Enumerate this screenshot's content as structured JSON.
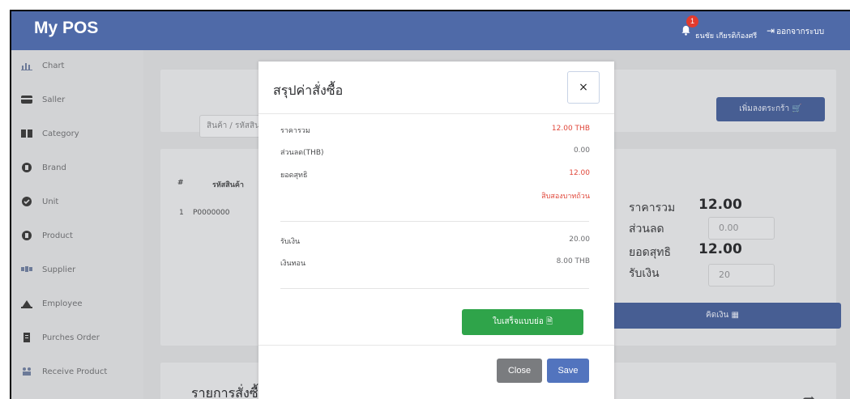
{
  "topbar": {
    "brand": "My POS",
    "notification_count": "1",
    "user_name": "ธนชัย เกียรติก้องศรี",
    "logout_label": "ออกจากระบบ"
  },
  "sidebar": {
    "items": [
      {
        "label": "Chart",
        "icon": "chart-icon"
      },
      {
        "label": "Saller",
        "icon": "seller-icon"
      },
      {
        "label": "Category",
        "icon": "category-icon"
      },
      {
        "label": "Brand",
        "icon": "brand-icon"
      },
      {
        "label": "Unit",
        "icon": "unit-icon"
      },
      {
        "label": "Product",
        "icon": "product-icon"
      },
      {
        "label": "Supplier",
        "icon": "supplier-icon"
      },
      {
        "label": "Employee",
        "icon": "employee-icon"
      },
      {
        "label": "Purches Order",
        "icon": "purchase-order-icon"
      },
      {
        "label": "Receive Product",
        "icon": "receive-product-icon"
      }
    ]
  },
  "main": {
    "search_placeholder": "สินค้า / รหัสสินค้า",
    "add_cart_label": "เพิ่มลงตระกร้า",
    "table_headers": [
      "#",
      "รหัสสินค้า"
    ],
    "table_rows": [
      [
        "1",
        "P0000000"
      ]
    ],
    "summary": {
      "total_label": "ราคารวม",
      "total_value": "12.00",
      "discount_label": "ส่วนลด",
      "discount_value": "0.00",
      "net_label": "ยอดสุทธิ",
      "net_value": "12.00",
      "received_label": "รับเงิน",
      "received_value": "20"
    },
    "pay_label": "คิดเงิน",
    "order_list_title": "รายการสั่งซื้อ"
  },
  "modal": {
    "title": "สรุปค่าสั่งซื้อ",
    "close_x": "×",
    "rows": {
      "total_label": "ราคารวม",
      "total_value": "12.00 THB",
      "discount_label": "ส่วนลด(THB)",
      "discount_value": "0.00",
      "net_label": "ยอดสุทธิ",
      "net_value": "12.00",
      "net_text": "สิบสองบาทถ้วน",
      "received_label": "รับเงิน",
      "received_value": "20.00",
      "change_label": "เงินทอน",
      "change_value": "8.00 THB"
    },
    "receipt_button": "ใบเสร็จแบบย่อ",
    "close_button": "Close",
    "save_button": "Save"
  },
  "colors": {
    "topbar": "#4f6aa8",
    "red_value": "#e0473a",
    "receipt_button": "#2fa44a",
    "save_button": "#5274be",
    "close_button": "#7a7c7f"
  }
}
